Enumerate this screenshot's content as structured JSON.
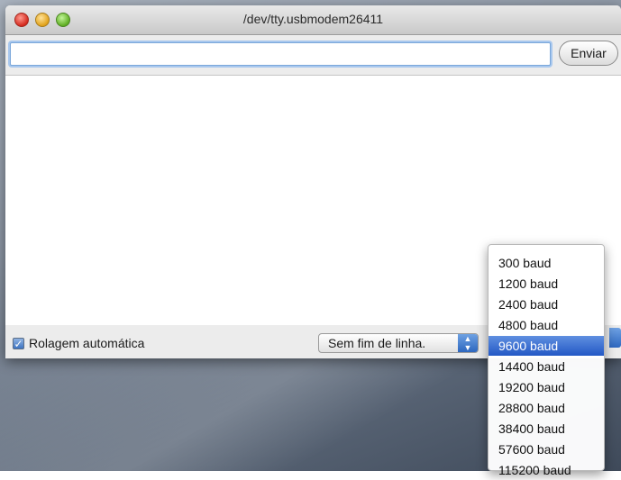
{
  "window": {
    "title": "/dev/tty.usbmodem26411"
  },
  "send": {
    "input_value": "",
    "button_label": "Enviar"
  },
  "bottom": {
    "autoscroll_label": "Rolagem automática",
    "autoscroll_checked": true,
    "line_ending_value": "Sem fim de linha."
  },
  "baud_menu": {
    "selected": "9600 baud",
    "items": [
      {
        "label": "300 baud"
      },
      {
        "label": "1200 baud"
      },
      {
        "label": "2400 baud"
      },
      {
        "label": "4800 baud"
      },
      {
        "label": "9600 baud"
      },
      {
        "label": "14400 baud"
      },
      {
        "label": "19200 baud"
      },
      {
        "label": "28800 baud"
      },
      {
        "label": "38400 baud"
      },
      {
        "label": "57600 baud"
      },
      {
        "label": "115200 baud"
      }
    ]
  },
  "colors": {
    "selection": "#2f68c9",
    "close": "#d42a1e",
    "minimize": "#e1a21a",
    "maximize": "#5fae22"
  }
}
